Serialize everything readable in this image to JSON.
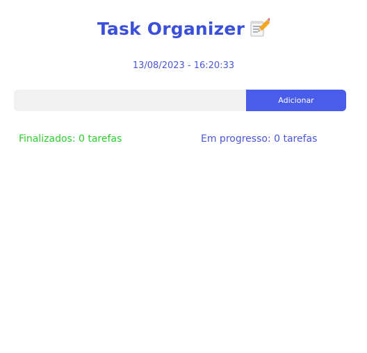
{
  "header": {
    "title": "Task Organizer",
    "title_icon": "memo-pencil-icon",
    "datetime": "13/08/2023 - 16:20:33"
  },
  "form": {
    "input_value": "",
    "input_placeholder": "",
    "add_label": "Adicionar"
  },
  "stats": {
    "done_text": "Finalizados: 0 tarefas",
    "in_progress_text": "Em progresso: 0 tarefas"
  },
  "colors": {
    "accent": "#3b4fd9",
    "button": "#4a5de8",
    "done": "#2ecc2e",
    "input_bg": "#f1f1f1"
  }
}
